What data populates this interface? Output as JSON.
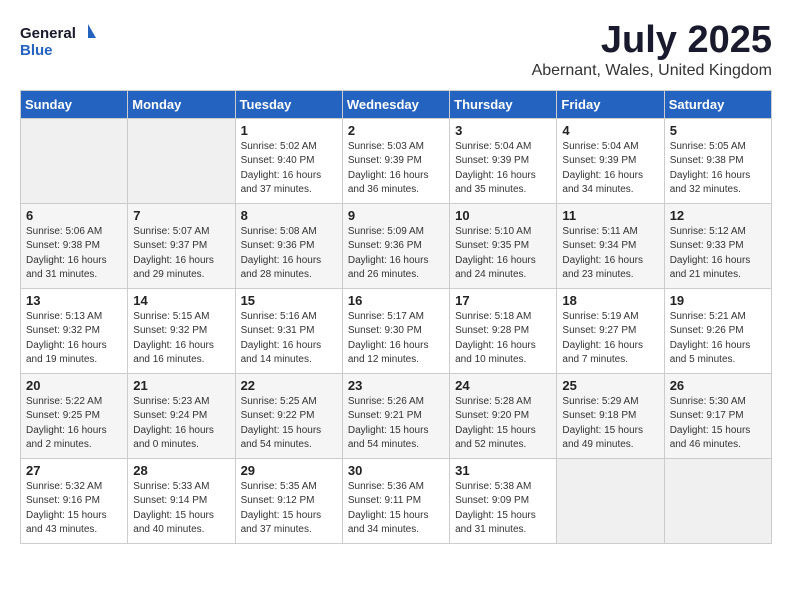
{
  "logo": {
    "general": "General",
    "blue": "Blue"
  },
  "title": "July 2025",
  "subtitle": "Abernant, Wales, United Kingdom",
  "days_of_week": [
    "Sunday",
    "Monday",
    "Tuesday",
    "Wednesday",
    "Thursday",
    "Friday",
    "Saturday"
  ],
  "weeks": [
    [
      {
        "day": "",
        "info": ""
      },
      {
        "day": "",
        "info": ""
      },
      {
        "day": "1",
        "info": "Sunrise: 5:02 AM\nSunset: 9:40 PM\nDaylight: 16 hours\nand 37 minutes."
      },
      {
        "day": "2",
        "info": "Sunrise: 5:03 AM\nSunset: 9:39 PM\nDaylight: 16 hours\nand 36 minutes."
      },
      {
        "day": "3",
        "info": "Sunrise: 5:04 AM\nSunset: 9:39 PM\nDaylight: 16 hours\nand 35 minutes."
      },
      {
        "day": "4",
        "info": "Sunrise: 5:04 AM\nSunset: 9:39 PM\nDaylight: 16 hours\nand 34 minutes."
      },
      {
        "day": "5",
        "info": "Sunrise: 5:05 AM\nSunset: 9:38 PM\nDaylight: 16 hours\nand 32 minutes."
      }
    ],
    [
      {
        "day": "6",
        "info": "Sunrise: 5:06 AM\nSunset: 9:38 PM\nDaylight: 16 hours\nand 31 minutes."
      },
      {
        "day": "7",
        "info": "Sunrise: 5:07 AM\nSunset: 9:37 PM\nDaylight: 16 hours\nand 29 minutes."
      },
      {
        "day": "8",
        "info": "Sunrise: 5:08 AM\nSunset: 9:36 PM\nDaylight: 16 hours\nand 28 minutes."
      },
      {
        "day": "9",
        "info": "Sunrise: 5:09 AM\nSunset: 9:36 PM\nDaylight: 16 hours\nand 26 minutes."
      },
      {
        "day": "10",
        "info": "Sunrise: 5:10 AM\nSunset: 9:35 PM\nDaylight: 16 hours\nand 24 minutes."
      },
      {
        "day": "11",
        "info": "Sunrise: 5:11 AM\nSunset: 9:34 PM\nDaylight: 16 hours\nand 23 minutes."
      },
      {
        "day": "12",
        "info": "Sunrise: 5:12 AM\nSunset: 9:33 PM\nDaylight: 16 hours\nand 21 minutes."
      }
    ],
    [
      {
        "day": "13",
        "info": "Sunrise: 5:13 AM\nSunset: 9:32 PM\nDaylight: 16 hours\nand 19 minutes."
      },
      {
        "day": "14",
        "info": "Sunrise: 5:15 AM\nSunset: 9:32 PM\nDaylight: 16 hours\nand 16 minutes."
      },
      {
        "day": "15",
        "info": "Sunrise: 5:16 AM\nSunset: 9:31 PM\nDaylight: 16 hours\nand 14 minutes."
      },
      {
        "day": "16",
        "info": "Sunrise: 5:17 AM\nSunset: 9:30 PM\nDaylight: 16 hours\nand 12 minutes."
      },
      {
        "day": "17",
        "info": "Sunrise: 5:18 AM\nSunset: 9:28 PM\nDaylight: 16 hours\nand 10 minutes."
      },
      {
        "day": "18",
        "info": "Sunrise: 5:19 AM\nSunset: 9:27 PM\nDaylight: 16 hours\nand 7 minutes."
      },
      {
        "day": "19",
        "info": "Sunrise: 5:21 AM\nSunset: 9:26 PM\nDaylight: 16 hours\nand 5 minutes."
      }
    ],
    [
      {
        "day": "20",
        "info": "Sunrise: 5:22 AM\nSunset: 9:25 PM\nDaylight: 16 hours\nand 2 minutes."
      },
      {
        "day": "21",
        "info": "Sunrise: 5:23 AM\nSunset: 9:24 PM\nDaylight: 16 hours\nand 0 minutes."
      },
      {
        "day": "22",
        "info": "Sunrise: 5:25 AM\nSunset: 9:22 PM\nDaylight: 15 hours\nand 54 minutes."
      },
      {
        "day": "23",
        "info": "Sunrise: 5:26 AM\nSunset: 9:21 PM\nDaylight: 15 hours\nand 54 minutes."
      },
      {
        "day": "24",
        "info": "Sunrise: 5:28 AM\nSunset: 9:20 PM\nDaylight: 15 hours\nand 52 minutes."
      },
      {
        "day": "25",
        "info": "Sunrise: 5:29 AM\nSunset: 9:18 PM\nDaylight: 15 hours\nand 49 minutes."
      },
      {
        "day": "26",
        "info": "Sunrise: 5:30 AM\nSunset: 9:17 PM\nDaylight: 15 hours\nand 46 minutes."
      }
    ],
    [
      {
        "day": "27",
        "info": "Sunrise: 5:32 AM\nSunset: 9:16 PM\nDaylight: 15 hours\nand 43 minutes."
      },
      {
        "day": "28",
        "info": "Sunrise: 5:33 AM\nSunset: 9:14 PM\nDaylight: 15 hours\nand 40 minutes."
      },
      {
        "day": "29",
        "info": "Sunrise: 5:35 AM\nSunset: 9:12 PM\nDaylight: 15 hours\nand 37 minutes."
      },
      {
        "day": "30",
        "info": "Sunrise: 5:36 AM\nSunset: 9:11 PM\nDaylight: 15 hours\nand 34 minutes."
      },
      {
        "day": "31",
        "info": "Sunrise: 5:38 AM\nSunset: 9:09 PM\nDaylight: 15 hours\nand 31 minutes."
      },
      {
        "day": "",
        "info": ""
      },
      {
        "day": "",
        "info": ""
      }
    ]
  ]
}
